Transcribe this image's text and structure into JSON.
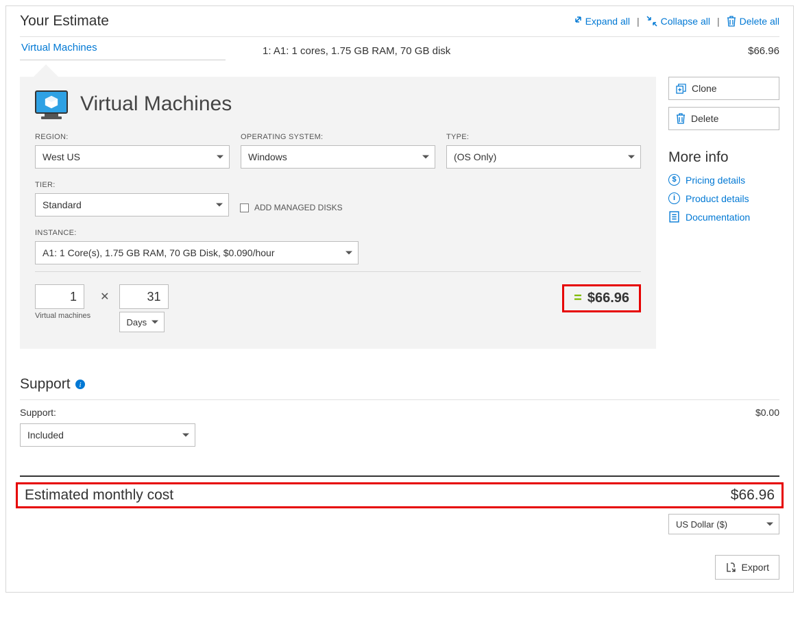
{
  "header": {
    "title": "Your Estimate",
    "expand_all": "Expand all",
    "collapse_all": "Collapse all",
    "delete_all": "Delete all"
  },
  "summary": {
    "name": "Virtual Machines",
    "description": "1: A1: 1 cores, 1.75 GB RAM, 70 GB disk",
    "cost": "$66.96"
  },
  "card": {
    "title": "Virtual Machines",
    "fields": {
      "region_label": "REGION:",
      "region_value": "West US",
      "os_label": "OPERATING SYSTEM:",
      "os_value": "Windows",
      "type_label": "TYPE:",
      "type_value": "(OS Only)",
      "tier_label": "TIER:",
      "tier_value": "Standard",
      "managed_disks_label": "ADD MANAGED DISKS",
      "instance_label": "INSTANCE:",
      "instance_value": "A1: 1 Core(s), 1.75 GB RAM, 70 GB Disk, $0.090/hour"
    },
    "qty": {
      "vm_count": "1",
      "vm_label": "Virtual machines",
      "duration": "31",
      "duration_unit": "Days"
    },
    "result": "$66.96"
  },
  "side": {
    "clone": "Clone",
    "delete": "Delete",
    "more_info": "More info",
    "pricing": "Pricing details",
    "product": "Product details",
    "docs": "Documentation"
  },
  "support": {
    "title": "Support",
    "label": "Support:",
    "cost": "$0.00",
    "value": "Included"
  },
  "total": {
    "label": "Estimated monthly cost",
    "cost": "$66.96",
    "currency": "US Dollar ($)"
  },
  "export_label": "Export"
}
